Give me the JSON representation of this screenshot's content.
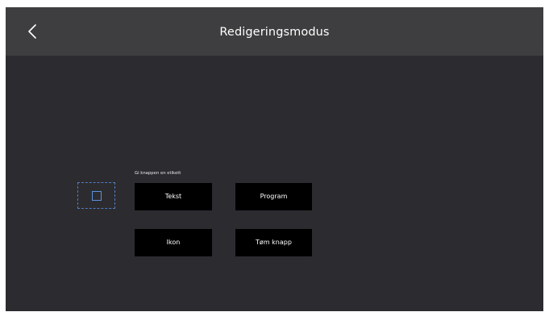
{
  "header": {
    "title": "Redigeringsmodus",
    "back_icon": "chevron-left-icon"
  },
  "prompt": "Gi knappen en etikett",
  "icon_slot": {
    "icon": "square-outline-icon",
    "accent_color": "#5a92e0"
  },
  "options": {
    "tekst": "Tekst",
    "program": "Program",
    "ikon": "Ikon",
    "tom_knapp": "Tøm knapp"
  },
  "colors": {
    "background": "#2c2b2f",
    "header": "#3e3e40",
    "button": "#000000",
    "text": "#ffffff"
  }
}
